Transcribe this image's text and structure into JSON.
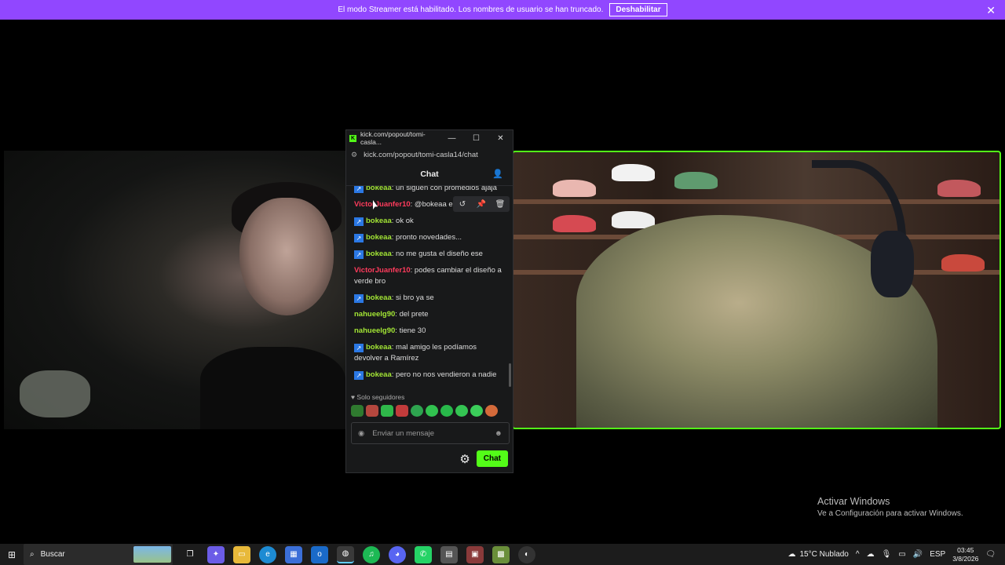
{
  "banner": {
    "text": "El modo Streamer está habilitado. Los nombres de usuario se han truncado.",
    "button": "Deshabilitar",
    "close": "✕"
  },
  "popup": {
    "tab_title": "kick.com/popout/tomi-casla...",
    "url": "kick.com/popout/tomi-casla14/chat",
    "header": "Chat",
    "messages": [
      {
        "user": "bokeaa",
        "text": "un siguen con promedios ajaja",
        "badge": true,
        "color": "green"
      },
      {
        "user": "VictorJuanfer10",
        "text": "@bokeaa e",
        "badge": false,
        "color": "red"
      },
      {
        "user": "bokeaa",
        "text": "ok ok",
        "badge": true,
        "color": "green"
      },
      {
        "user": "bokeaa",
        "text": "pronto novedades...",
        "badge": true,
        "color": "green"
      },
      {
        "user": "bokeaa",
        "text": "no me gusta el diseño ese",
        "badge": true,
        "color": "green"
      },
      {
        "user": "VictorJuanfer10",
        "text": "podes cambiar el diseño a verde bro",
        "badge": false,
        "color": "red"
      },
      {
        "user": "bokeaa",
        "text": "si bro ya se",
        "badge": true,
        "color": "green"
      },
      {
        "user": "nahueelg90",
        "text": "del prete",
        "badge": false,
        "color": "green"
      },
      {
        "user": "nahueelg90",
        "text": "tiene 30",
        "badge": false,
        "color": "green"
      },
      {
        "user": "bokeaa",
        "text": "mal amigo les podíamos devolver a Ramírez",
        "badge": true,
        "color": "green"
      },
      {
        "user": "bokeaa",
        "text": "pero no nos vendieron a nadie",
        "badge": true,
        "color": "green"
      }
    ],
    "followers_only": "Solo seguidores",
    "input_placeholder": "Enviar un mensaje",
    "send_button": "Chat"
  },
  "watermark": {
    "line1": "Activar Windows",
    "line2": "Ve a Configuración para activar Windows."
  },
  "taskbar": {
    "search": "Buscar",
    "weather": "15°C  Nublado",
    "lang": "ESP",
    "time": "03:45",
    "date": "3/8/2026"
  },
  "colors": {
    "kick_green": "#53fc18",
    "streamer_banner": "#9147ff",
    "badge_blue": "#2b78e4",
    "username_red": "#ff3b5c",
    "username_green": "#a3e635"
  }
}
